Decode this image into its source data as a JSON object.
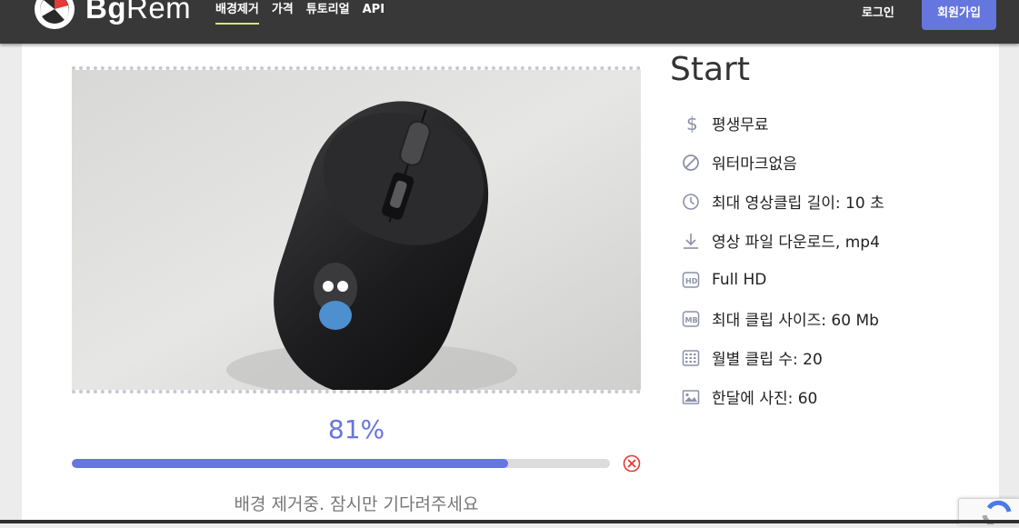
{
  "brand": {
    "bold": "Bg",
    "light": "Rem"
  },
  "nav": {
    "items": [
      {
        "label": "배경제거",
        "active": true
      },
      {
        "label": "가격"
      },
      {
        "label": "튜토리얼"
      },
      {
        "label": "API"
      }
    ],
    "login": "로그인",
    "signup": "회원가입"
  },
  "processing": {
    "progress_percent": 81,
    "percent_text": "81%",
    "status_text": "배경 제거중. 잠시만 기다려주세요"
  },
  "plan": {
    "title": "Start",
    "features": [
      {
        "icon": "dollar-icon",
        "label": "평생무료"
      },
      {
        "icon": "no-watermark-icon",
        "label": "워터마크없음"
      },
      {
        "icon": "clock-icon",
        "label": "최대 영상클립 길이: 10 초"
      },
      {
        "icon": "download-icon",
        "label": "영상 파일 다운로드, mp4"
      },
      {
        "icon": "hd-icon",
        "label": "Full HD"
      },
      {
        "icon": "mb-icon",
        "label": "최대 클립 사이즈: 60 Mb"
      },
      {
        "icon": "calendar-icon",
        "label": "월별 클립 수: 20"
      },
      {
        "icon": "image-icon",
        "label": "한달에 사진: 60"
      }
    ]
  },
  "colors": {
    "accent": "#6576de",
    "nav_bg": "#383838",
    "active_underline": "#d9e37a"
  }
}
